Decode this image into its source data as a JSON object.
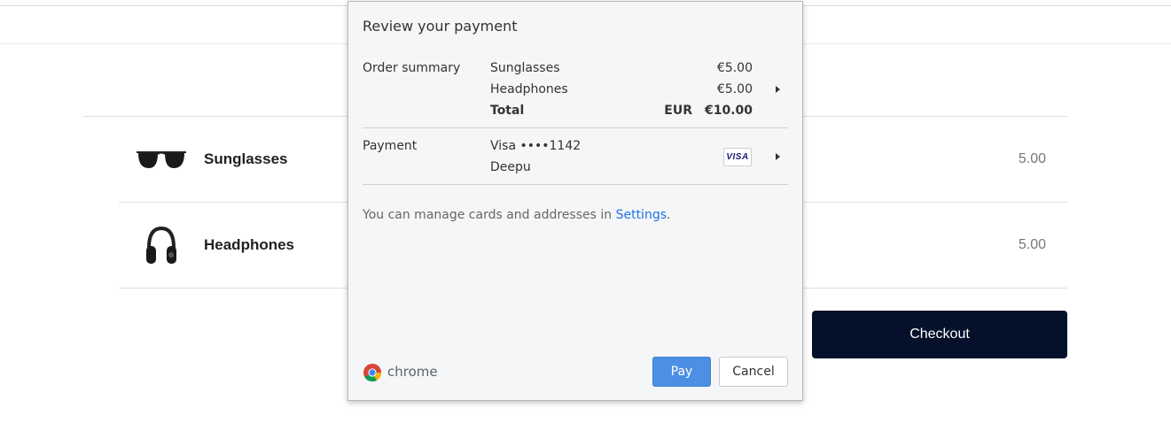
{
  "cart": {
    "items": [
      {
        "name": "Sunglasses",
        "price": "5.00",
        "icon": "sunglasses-icon"
      },
      {
        "name": "Headphones",
        "price": "5.00",
        "icon": "headphones-icon"
      }
    ],
    "checkout_label": "Checkout"
  },
  "dialog": {
    "title": "Review your payment",
    "order_summary": {
      "label": "Order summary",
      "items": [
        {
          "name": "Sunglasses",
          "amount": "€5.00"
        },
        {
          "name": "Headphones",
          "amount": "€5.00"
        }
      ],
      "total_label": "Total",
      "currency": "EUR",
      "total_amount": "€10.00"
    },
    "payment": {
      "label": "Payment",
      "card": "Visa ••••1142",
      "holder": "Deepu",
      "card_brand": "VISA"
    },
    "note_text": "You can manage cards and addresses in ",
    "note_link": "Settings",
    "note_end": ".",
    "brand": "chrome",
    "pay_label": "Pay",
    "cancel_label": "Cancel"
  },
  "colors": {
    "checkout_bg": "#05112b",
    "pay_bg": "#4d8fe4",
    "link": "#1a73e8"
  }
}
